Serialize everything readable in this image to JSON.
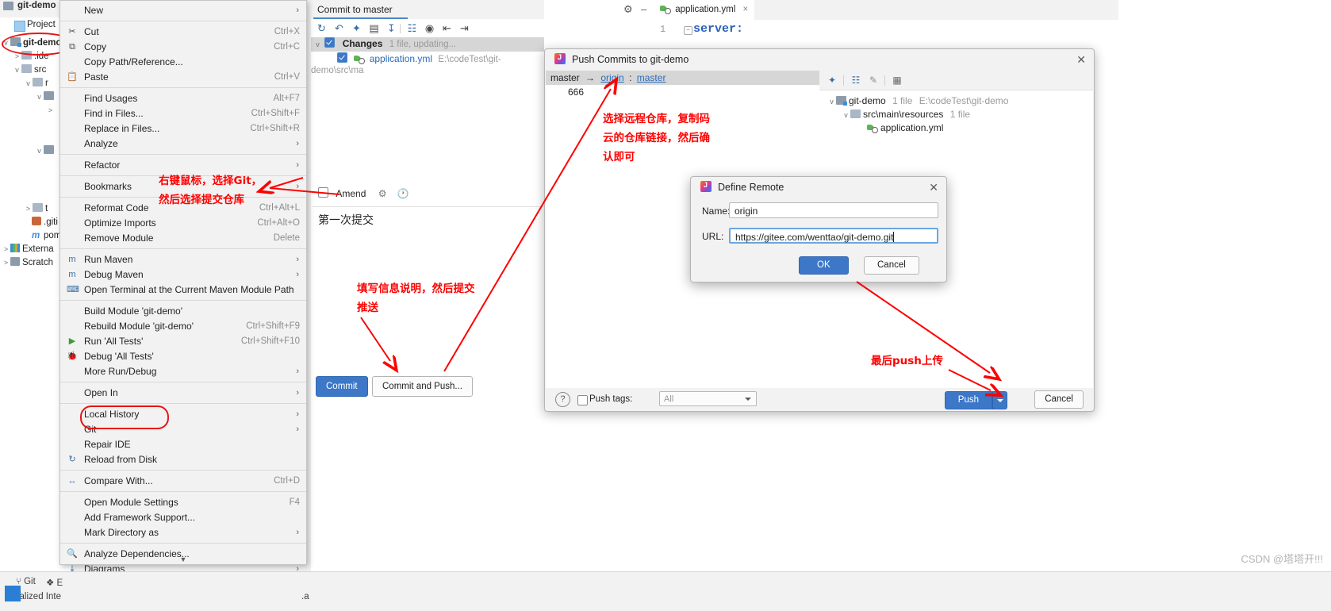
{
  "ide": {
    "project_tab": "Project",
    "tree": [
      {
        "label": "git-demo",
        "bold": true,
        "indent": 4,
        "chev": "v",
        "icon": "folder-module"
      },
      {
        "label": ".ide",
        "bold": false,
        "indent": 18,
        "chev": ">",
        "icon": "folder"
      },
      {
        "label": "src",
        "bold": false,
        "indent": 18,
        "chev": "v",
        "icon": "folder"
      },
      {
        "label": "r",
        "bold": false,
        "indent": 32,
        "chev": "v",
        "icon": "folder"
      },
      {
        "label": "",
        "bold": false,
        "indent": 46,
        "chev": "v",
        "icon": "folder-blue"
      },
      {
        "label": "",
        "bold": false,
        "indent": 60,
        "chev": "",
        "icon": "none"
      },
      {
        "label": "",
        "bold": false,
        "indent": 46,
        "chev": "v",
        "icon": "folder-blue"
      },
      {
        "label": "t",
        "bold": false,
        "indent": 32,
        "chev": ">",
        "icon": "folder"
      },
      {
        "label": ".giti",
        "bold": false,
        "indent": 32,
        "chev": "",
        "icon": "gitignore"
      },
      {
        "label": "pom",
        "bold": false,
        "indent": 32,
        "chev": "",
        "icon": "maven"
      },
      {
        "label": "Externa",
        "bold": false,
        "indent": 4,
        "chev": ">",
        "icon": "library"
      },
      {
        "label": "Scratch",
        "bold": false,
        "indent": 4,
        "chev": ">",
        "icon": "scratch"
      }
    ],
    "editor": {
      "tab_label": "application.yml",
      "tab_close": "×",
      "line_numbers": [
        "1"
      ],
      "code_lines": [
        "server:"
      ]
    },
    "status_bar": {
      "git_label": "Git",
      "e_label": "E",
      "localized_label": "Localized Inte"
    },
    "watermark": "CSDN @塔塔开!!!"
  },
  "context_menu": {
    "items": [
      {
        "label": "New",
        "accel": "",
        "arrow": true,
        "icon": "",
        "sep_after": true
      },
      {
        "label": "Cut",
        "accel": "Ctrl+X",
        "arrow": false,
        "icon": "scissors-icon",
        "sep_after": false
      },
      {
        "label": "Copy",
        "accel": "Ctrl+C",
        "arrow": false,
        "icon": "copy-icon",
        "sep_after": false
      },
      {
        "label": "Copy Path/Reference...",
        "accel": "",
        "arrow": false,
        "icon": "",
        "sep_after": false
      },
      {
        "label": "Paste",
        "accel": "Ctrl+V",
        "arrow": false,
        "icon": "paste-icon",
        "sep_after": true
      },
      {
        "label": "Find Usages",
        "accel": "Alt+F7",
        "arrow": false,
        "icon": "",
        "sep_after": false
      },
      {
        "label": "Find in Files...",
        "accel": "Ctrl+Shift+F",
        "arrow": false,
        "icon": "",
        "sep_after": false
      },
      {
        "label": "Replace in Files...",
        "accel": "Ctrl+Shift+R",
        "arrow": false,
        "icon": "",
        "sep_after": false
      },
      {
        "label": "Analyze",
        "accel": "",
        "arrow": true,
        "icon": "",
        "sep_after": true
      },
      {
        "label": "Refactor",
        "accel": "",
        "arrow": true,
        "icon": "",
        "sep_after": true
      },
      {
        "label": "Bookmarks",
        "accel": "",
        "arrow": true,
        "icon": "",
        "sep_after": true
      },
      {
        "label": "Reformat Code",
        "accel": "Ctrl+Alt+L",
        "arrow": false,
        "icon": "",
        "sep_after": false
      },
      {
        "label": "Optimize Imports",
        "accel": "Ctrl+Alt+O",
        "arrow": false,
        "icon": "",
        "sep_after": false
      },
      {
        "label": "Remove Module",
        "accel": "Delete",
        "arrow": false,
        "icon": "",
        "sep_after": true
      },
      {
        "label": "Run Maven",
        "accel": "",
        "arrow": true,
        "icon": "maven-run-icon",
        "sep_after": false
      },
      {
        "label": "Debug Maven",
        "accel": "",
        "arrow": true,
        "icon": "maven-debug-icon",
        "sep_after": false
      },
      {
        "label": "Open Terminal at the Current Maven Module Path",
        "accel": "",
        "arrow": false,
        "icon": "terminal-icon",
        "sep_after": true
      },
      {
        "label": "Build Module 'git-demo'",
        "accel": "",
        "arrow": false,
        "icon": "",
        "sep_after": false
      },
      {
        "label": "Rebuild Module 'git-demo'",
        "accel": "Ctrl+Shift+F9",
        "arrow": false,
        "icon": "",
        "sep_after": false
      },
      {
        "label": "Run 'All Tests'",
        "accel": "Ctrl+Shift+F10",
        "arrow": false,
        "icon": "run-icon",
        "sep_after": false
      },
      {
        "label": "Debug 'All Tests'",
        "accel": "",
        "arrow": false,
        "icon": "debug-icon",
        "sep_after": false
      },
      {
        "label": "More Run/Debug",
        "accel": "",
        "arrow": true,
        "icon": "",
        "sep_after": true
      },
      {
        "label": "Open In",
        "accel": "",
        "arrow": true,
        "icon": "",
        "sep_after": true
      },
      {
        "label": "Local History",
        "accel": "",
        "arrow": true,
        "icon": "",
        "sep_after": false
      },
      {
        "label": "Git",
        "accel": "",
        "arrow": true,
        "icon": "",
        "sep_after": false
      },
      {
        "label": "Repair IDE",
        "accel": "",
        "arrow": false,
        "icon": "",
        "sep_after": false
      },
      {
        "label": "Reload from Disk",
        "accel": "",
        "arrow": false,
        "icon": "reload-icon",
        "sep_after": true
      },
      {
        "label": "Compare With...",
        "accel": "Ctrl+D",
        "arrow": false,
        "icon": "compare-icon",
        "sep_after": true
      },
      {
        "label": "Open Module Settings",
        "accel": "F4",
        "arrow": false,
        "icon": "",
        "sep_after": false
      },
      {
        "label": "Add Framework Support...",
        "accel": "",
        "arrow": false,
        "icon": "",
        "sep_after": false
      },
      {
        "label": "Mark Directory as",
        "accel": "",
        "arrow": true,
        "icon": "",
        "sep_after": true
      },
      {
        "label": "Analyze Dependencies...",
        "accel": "",
        "arrow": false,
        "icon": "analyze-icon",
        "sep_after": false
      },
      {
        "label": "Diagrams",
        "accel": "",
        "arrow": true,
        "icon": "diagram-icon",
        "sep_after": false
      }
    ],
    "scroll_down_glyph": "▼"
  },
  "commit_panel": {
    "tab_title": "Commit to master",
    "changes_label": "Changes",
    "changes_info": "1 file, updating...",
    "file_name": "application.yml",
    "file_path": "E:\\codeTest\\git-demo\\src\\ma",
    "amend_label": "Amend",
    "message": "第一次提交",
    "commit_button": "Commit",
    "commit_and_push_button": "Commit and Push..."
  },
  "push_dialog": {
    "title": "Push Commits to git-demo",
    "close": "✕",
    "branch_from": "master",
    "branch_arrow": "→",
    "branch_remote": "origin",
    "branch_colon": ":",
    "branch_to": "master",
    "commit_message": "666",
    "tree": [
      {
        "label": "git-demo",
        "meta": "1 file",
        "path": "E:\\codeTest\\git-demo",
        "indent": 10,
        "chev": "v",
        "icon": "folder-module"
      },
      {
        "label": "src\\main\\resources",
        "meta": "1 file",
        "path": "",
        "indent": 28,
        "chev": "v",
        "icon": "folder"
      },
      {
        "label": "application.yml",
        "meta": "",
        "path": "",
        "indent": 46,
        "chev": "",
        "icon": "yml"
      }
    ],
    "push_tags_label": "Push tags:",
    "push_tags_value": "All",
    "help_glyph": "?",
    "push_button": "Push",
    "cancel_button": "Cancel"
  },
  "define_remote": {
    "title": "Define Remote",
    "close": "✕",
    "name_label": "Name:",
    "name_value": "origin",
    "url_label": "URL:",
    "url_value": "https://gitee.com/wenttao/git-demo.git",
    "ok_button": "OK",
    "cancel_button": "Cancel"
  },
  "annotations": {
    "color": "#ff0000",
    "notes": [
      {
        "id": "note-right-click",
        "lines": [
          "右键鼠标，选择Git，",
          "然后选择提交仓库"
        ]
      },
      {
        "id": "note-fill-message",
        "lines": [
          "填写信息说明，然后提交",
          "推送"
        ]
      },
      {
        "id": "note-choose-remote",
        "lines": [
          "选择远程仓库，复制码",
          "云的仓库链接，然后确",
          "认即可"
        ]
      },
      {
        "id": "note-final-push",
        "lines": [
          "最后push上传"
        ]
      }
    ]
  }
}
